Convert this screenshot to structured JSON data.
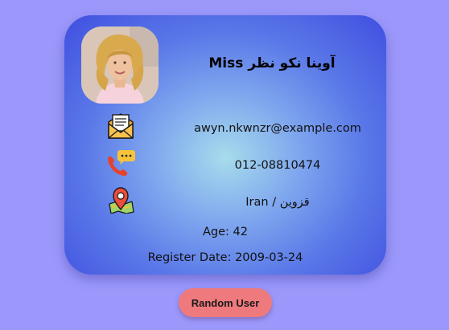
{
  "profile": {
    "name": "Miss آوینا نکو نظر",
    "email": "awyn.nkwnzr@example.com",
    "phone": "012-08810474",
    "location": "Iran / قزوین",
    "age_line": "Age: 42",
    "register_line": "Register Date: 2009-03-24"
  },
  "icons": {
    "email": "envelope-letter-icon",
    "phone": "phone-chat-icon",
    "location": "map-pin-icon"
  },
  "actions": {
    "random_label": "Random User"
  },
  "colors": {
    "page_background": "#9c98fb",
    "card_edge": "#3f4ee0",
    "card_center": "#a7dcec",
    "button": "#ef7a7e"
  }
}
